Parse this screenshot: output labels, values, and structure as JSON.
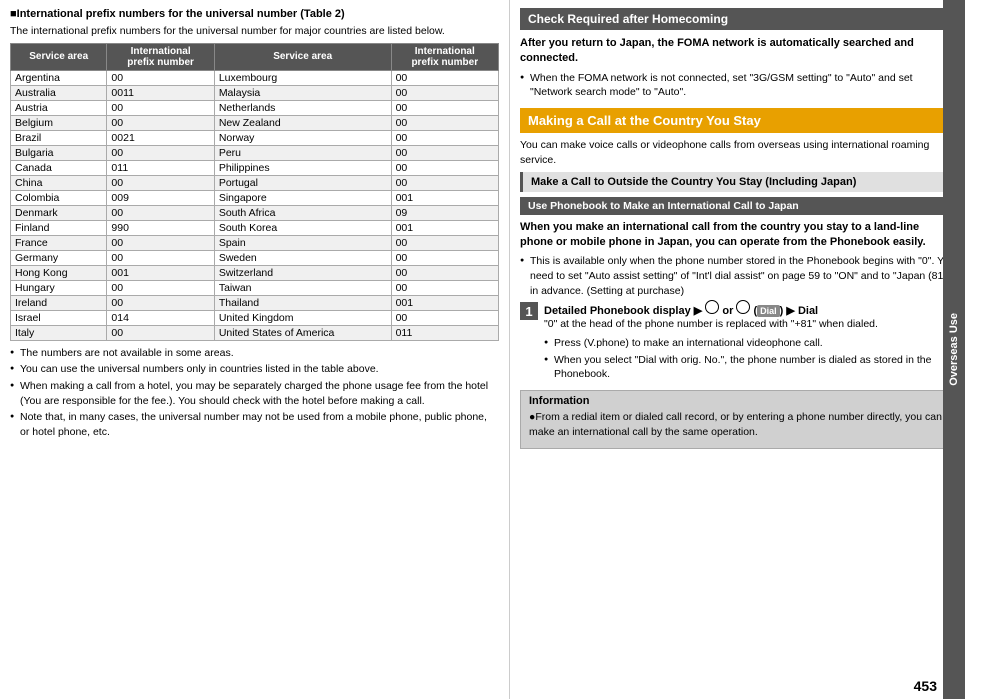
{
  "left": {
    "main_title": "■International prefix numbers for the universal number (Table 2)",
    "intro_text": "The international prefix numbers for the universal number for major countries are listed below.",
    "table": {
      "headers": [
        "Service area",
        "International prefix number",
        "Service area",
        "International prefix number"
      ],
      "rows": [
        [
          "Argentina",
          "00",
          "Luxembourg",
          "00"
        ],
        [
          "Australia",
          "0011",
          "Malaysia",
          "00"
        ],
        [
          "Austria",
          "00",
          "Netherlands",
          "00"
        ],
        [
          "Belgium",
          "00",
          "New Zealand",
          "00"
        ],
        [
          "Brazil",
          "0021",
          "Norway",
          "00"
        ],
        [
          "Bulgaria",
          "00",
          "Peru",
          "00"
        ],
        [
          "Canada",
          "011",
          "Philippines",
          "00"
        ],
        [
          "China",
          "00",
          "Portugal",
          "00"
        ],
        [
          "Colombia",
          "009",
          "Singapore",
          "001"
        ],
        [
          "Denmark",
          "00",
          "South Africa",
          "09"
        ],
        [
          "Finland",
          "990",
          "South Korea",
          "001"
        ],
        [
          "France",
          "00",
          "Spain",
          "00"
        ],
        [
          "Germany",
          "00",
          "Sweden",
          "00"
        ],
        [
          "Hong Kong",
          "001",
          "Switzerland",
          "00"
        ],
        [
          "Hungary",
          "00",
          "Taiwan",
          "00"
        ],
        [
          "Ireland",
          "00",
          "Thailand",
          "001"
        ],
        [
          "Israel",
          "014",
          "United Kingdom",
          "00"
        ],
        [
          "Italy",
          "00",
          "United States of America",
          "011"
        ]
      ]
    },
    "bullets": [
      "The numbers are not available in some areas.",
      "You can use the universal numbers only in countries listed in the table above.",
      "When making a call from a hotel, you may be separately charged the phone usage fee from the hotel (You are responsible for the fee.). You should check with the hotel before making a call.",
      "Note that, in many cases, the universal number may not be used from a mobile phone, public phone, or hotel phone, etc."
    ]
  },
  "right": {
    "check_header": "Check Required after Homecoming",
    "check_body1": "After you return to Japan, the FOMA network is automatically searched and connected.",
    "check_bullet": "When the FOMA network is not connected, set \"3G/GSM setting\" to \"Auto\" and set \"Network search mode\" to \"Auto\".",
    "making_call_header": "Making a Call at the Country You Stay",
    "making_call_body": "You can make voice calls or videophone calls from overseas using international roaming service.",
    "make_call_subheader": "Make a Call to Outside the Country You Stay (Including Japan)",
    "use_phonebook_bar": "Use Phonebook to Make an International Call to Japan",
    "phonebook_body": "When you make an international call from the country you stay to a land-line phone or mobile phone in Japan, you can operate from the Phonebook easily.",
    "phonebook_bullet": "This is available only when the phone number stored in the Phonebook begins with \"0\". You need to set \"Auto assist setting\" of \"Int'l dial assist\" on page 59 to \"ON\" and to \"Japan (81)\" in advance. (Setting at purchase)",
    "step": {
      "number": "1",
      "title": "Detailed Phonebook display",
      "arrow": "▶",
      "circle_icon": "◯",
      "or_text": "or",
      "dial_label": "Dial",
      "sub_text1": "\"0\" at the head of the phone number is replaced with \"+81\" when dialed.",
      "sub_bullet1": "Press  (V.phone) to make an international videophone call.",
      "sub_bullet2": "When you select \"Dial with orig. No.\", the phone number is dialed as stored in the Phonebook."
    },
    "info_box": {
      "header": "Information",
      "text": "●From a redial item or dialed call record, or by entering a phone number directly, you can make an international call by the same operation."
    },
    "sidebar_label": "Overseas Use",
    "page_number": "453"
  }
}
